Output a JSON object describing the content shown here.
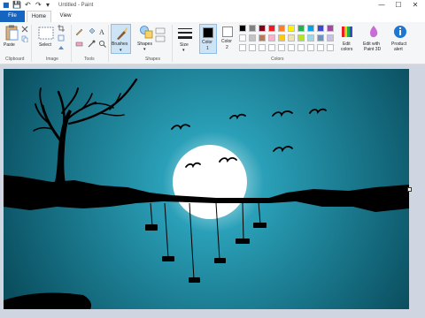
{
  "window": {
    "title": "Untitled - Paint",
    "minimize": "—",
    "maximize": "☐",
    "close": "✕"
  },
  "quick_access": {
    "save_glyph": "💾",
    "undo_glyph": "↶",
    "redo_glyph": "↷",
    "dropdown_glyph": "▾"
  },
  "tabs": {
    "file": "File",
    "home": "Home",
    "view": "View"
  },
  "ribbon": {
    "clipboard": {
      "paste": "Paste",
      "label": "Clipboard"
    },
    "image": {
      "select": "Select",
      "label": "Image"
    },
    "tools": {
      "label": "Tools"
    },
    "brushes": {
      "label": "Brushes"
    },
    "shapes": {
      "label": "Shapes",
      "group_label": "Shapes"
    },
    "size": {
      "label": "Size"
    },
    "color1": {
      "label": "Color",
      "sub": "1",
      "value": "#000000"
    },
    "color2": {
      "label": "Color",
      "sub": "2",
      "value": "#ffffff"
    },
    "colors_group": "Colors",
    "edit_colors": {
      "line1": "Edit",
      "line2": "colors"
    },
    "paint3d": {
      "line1": "Edit with",
      "line2": "Paint 3D"
    },
    "product_alert": {
      "line1": "Product",
      "line2": "alert"
    }
  },
  "palette_top": [
    "#000000",
    "#7f7f7f",
    "#880015",
    "#ed1c24",
    "#ff7f27",
    "#fff200",
    "#22b14c",
    "#00a2e8",
    "#3f48cc",
    "#a349a4"
  ],
  "palette_bottom": [
    "#ffffff",
    "#c3c3c3",
    "#b97a57",
    "#ffaec9",
    "#ffc90e",
    "#efe4b0",
    "#b5e61d",
    "#99d9ea",
    "#7092be",
    "#c8bfe7"
  ],
  "palette_empty": [
    "#ffffff",
    "#ffffff",
    "#ffffff",
    "#ffffff",
    "#ffffff",
    "#ffffff",
    "#ffffff",
    "#ffffff",
    "#ffffff",
    "#ffffff"
  ],
  "colors": {
    "sky_center": "#dff3f8",
    "sky_mid": "#2aa0b8",
    "sky_edge": "#0a4f60",
    "moon": "#ffffff",
    "silhouette": "#000000"
  }
}
